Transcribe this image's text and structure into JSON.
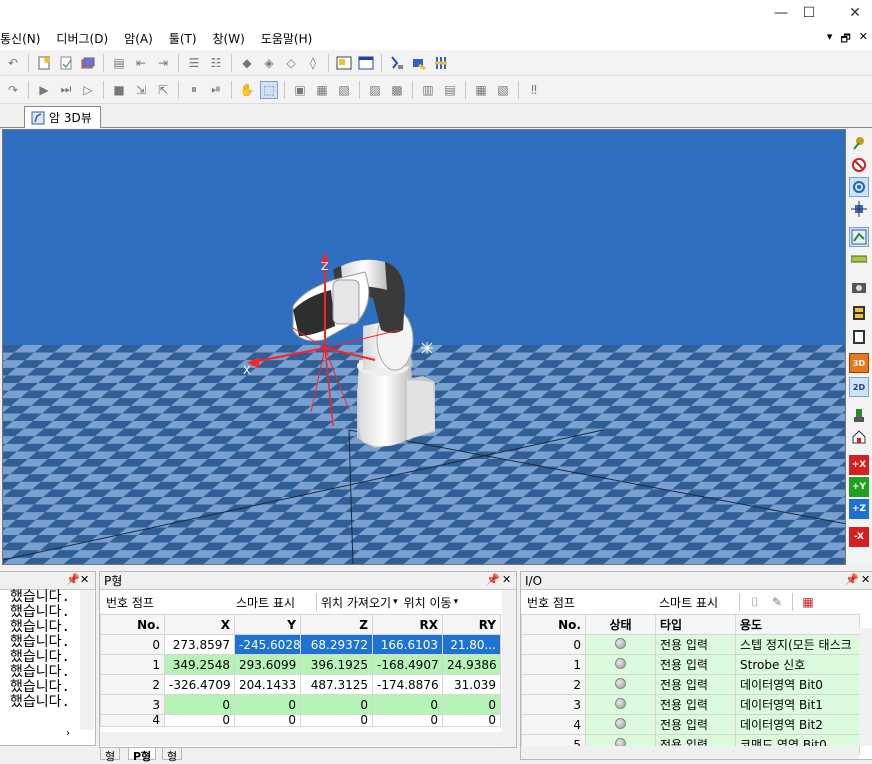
{
  "window": {
    "minimize_glyph": "—",
    "maximize_glyph": "☐",
    "close_glyph": "✕"
  },
  "menu": {
    "items": [
      "통신(N)",
      "디버그(D)",
      "암(A)",
      "툴(T)",
      "창(W)",
      "도움말(H)"
    ],
    "mdi_controls": [
      "▾",
      "🗗",
      "✕"
    ]
  },
  "tab": {
    "label": "암 3D뷰"
  },
  "viewport": {
    "axis_z_label": "Z",
    "axis_x_label": "X",
    "colors": {
      "sky": "#2f6fc0",
      "floor_dark": "#2f5f96",
      "floor_light": "#7aa0cf",
      "axis": "#ff2020"
    }
  },
  "right_toolbar": {
    "icons": [
      "robot-icon",
      "no-entry-icon",
      "rotate-view-icon",
      "move-view-icon",
      "layout-icon",
      "ruler-icon",
      "camera-icon",
      "film-icon",
      "film-record-icon",
      "view-3d-icon",
      "view-2d-icon",
      "robot-small-icon",
      "home-icon",
      "view-plus-x-icon",
      "view-plus-y-icon",
      "view-plus-z-icon",
      "view-minus-x-icon"
    ],
    "labels": {
      "view_3d": "3D",
      "view_2d": "2D",
      "plus_x": "+X",
      "plus_y": "+Y",
      "plus_z": "+Z",
      "minus_x": "-X"
    }
  },
  "log_panel": {
    "pin": "ᵖ",
    "lines": [
      "했습니다.",
      "했습니다.",
      "했습니다.",
      "했습니다.",
      "했습니다.",
      "했습니다.",
      "했습니다.",
      "했습니다."
    ]
  },
  "p_panel": {
    "title": "P형",
    "toolbar": {
      "number_jump": "번호 점프",
      "smart_display": "스마트 표시",
      "position_fetch": "위치 가져오기",
      "position_move": "위치 이동"
    },
    "columns": [
      "No.",
      "X",
      "Y",
      "Z",
      "RX",
      "RY"
    ],
    "rows": [
      {
        "no": "0",
        "x": "273.8597",
        "y": "-245.6028",
        "z": "68.29372",
        "rx": "166.6103",
        "ry": "21.80..."
      },
      {
        "no": "1",
        "x": "349.2548",
        "y": "293.6099",
        "z": "396.1925",
        "rx": "-168.4907",
        "ry": "24.9386"
      },
      {
        "no": "2",
        "x": "-326.4709",
        "y": "204.1433",
        "z": "487.3125",
        "rx": "-174.8876",
        "ry": "31.039"
      },
      {
        "no": "3",
        "x": "0",
        "y": "0",
        "z": "0",
        "rx": "0",
        "ry": "0"
      },
      {
        "no": "4",
        "x": "0",
        "y": "0",
        "z": "0",
        "rx": "0",
        "ry": "0"
      }
    ],
    "bottom_tabs": [
      "형",
      "P형",
      "형"
    ]
  },
  "io_panel": {
    "title": "I/O",
    "toolbar": {
      "number_jump": "번호 점프",
      "smart_display": "스마트 표시"
    },
    "columns": [
      "No.",
      "상태",
      "타입",
      "용도"
    ],
    "rows": [
      {
        "no": "0",
        "type": "전용 입력",
        "use": "스텝 정지(모든 태스크"
      },
      {
        "no": "1",
        "type": "전용 입력",
        "use": "Strobe 신호"
      },
      {
        "no": "2",
        "type": "전용 입력",
        "use": "데이터영역 Bit0"
      },
      {
        "no": "3",
        "type": "전용 입력",
        "use": "데이터영역 Bit1"
      },
      {
        "no": "4",
        "type": "전용 입력",
        "use": "데이터영역 Bit2"
      },
      {
        "no": "5",
        "type": "전용 입력",
        "use": "코맨드 영역 Bit0"
      }
    ]
  }
}
